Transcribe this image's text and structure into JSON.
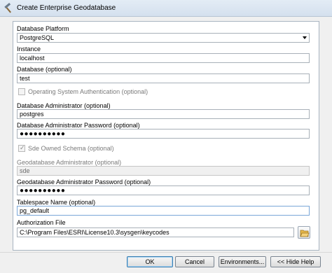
{
  "window": {
    "title": "Create Enterprise Geodatabase",
    "icon": "hammer-tool-icon"
  },
  "form": {
    "database_platform": {
      "label": "Database Platform",
      "value": "PostgreSQL"
    },
    "instance": {
      "label": "Instance",
      "value": "localhost"
    },
    "database": {
      "label": "Database (optional)",
      "value": "test"
    },
    "os_auth": {
      "label": "Operating System Authentication (optional)",
      "checked": false
    },
    "db_admin": {
      "label": "Database Administrator (optional)",
      "value": "postgres"
    },
    "db_admin_password": {
      "label": "Database Administrator Password (optional)",
      "value": "●●●●●●●●●●"
    },
    "sde_owned_schema": {
      "label": "Sde Owned Schema (optional)",
      "checked": true,
      "tick": "✓"
    },
    "gdb_admin": {
      "label": "Geodatabase Administrator (optional)",
      "value": "sde"
    },
    "gdb_admin_password": {
      "label": "Geodatabase Administrator Password (optional)",
      "value": "●●●●●●●●●●"
    },
    "tablespace": {
      "label": "Tablespace Name (optional)",
      "value": "pg_default"
    },
    "authorization_file": {
      "label": "Authorization File",
      "value": "C:\\Program Files\\ESRI\\License10.3\\sysgen\\keycodes",
      "browse_icon": "open-folder-icon"
    }
  },
  "buttons": {
    "ok": "OK",
    "cancel": "Cancel",
    "environments": "Environments...",
    "hide_help": "<< Hide Help"
  }
}
